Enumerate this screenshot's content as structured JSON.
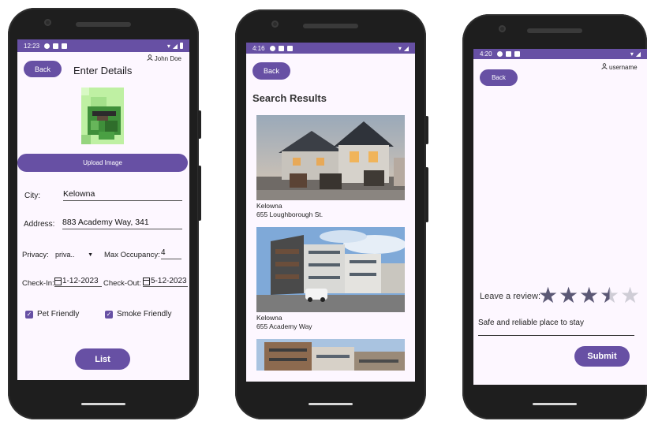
{
  "phone1": {
    "status_time": "12:23",
    "back_label": "Back",
    "user_name": "John Doe",
    "title": "Enter Details",
    "upload_label": "Upload Image",
    "city_label": "City:",
    "city_value": "Kelowna",
    "address_label": "Address:",
    "address_value": "883 Academy Way, 341",
    "privacy_label": "Privacy:",
    "privacy_value": "priva..",
    "max_occupancy_label": "Max Occupancy:",
    "max_occupancy_value": "4",
    "checkin_label": "Check-In:",
    "checkin_value": "1-12-2023",
    "checkout_label": "Check-Out:",
    "checkout_value": "5-12-2023",
    "pet_friendly_label": "Pet Friendly",
    "smoke_friendly_label": "Smoke Friendly",
    "list_label": "List"
  },
  "phone2": {
    "status_time": "4:16",
    "back_label": "Back",
    "title": "Search Results",
    "results": [
      {
        "city": "Kelowna",
        "address": "655 Loughborough St."
      },
      {
        "city": "Kelowna",
        "address": "655 Academy Way"
      }
    ]
  },
  "phone3": {
    "status_time": "4:20",
    "back_label": "Back",
    "user_name": "username",
    "review_label": "Leave a review:",
    "rating": 3.5,
    "rating_max": 5,
    "review_text": "Safe and reliable place to stay",
    "submit_label": "Submit"
  },
  "colors": {
    "primary": "#6750a4",
    "screen_bg": "#fdf7ff",
    "star_filled": "#5b5875",
    "star_empty": "#cfcdd6"
  },
  "icons": [
    "user-icon",
    "calendar-icon",
    "dropdown-arrow-icon",
    "check-icon",
    "star-icon",
    "wifi-icon",
    "battery-icon"
  ]
}
